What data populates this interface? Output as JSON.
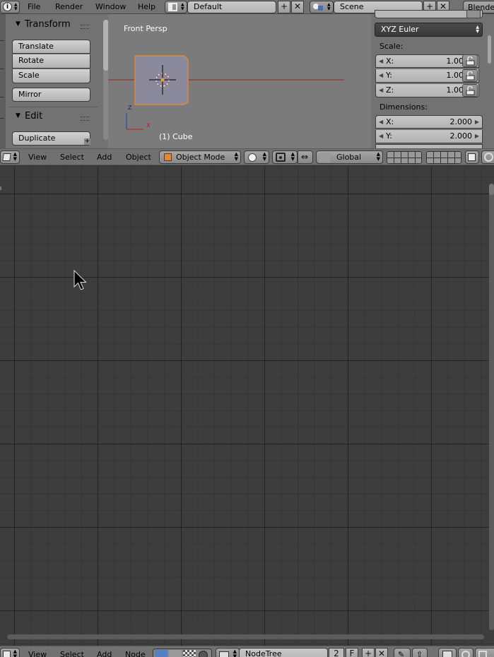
{
  "topbar": {
    "menus": [
      "File",
      "Render",
      "Window",
      "Help"
    ],
    "screen_layout": "Default",
    "scene": "Scene",
    "engine": "Blender"
  },
  "toolshelf": {
    "transform_header": "Transform",
    "transform_tools": [
      "Translate",
      "Rotate",
      "Scale"
    ],
    "mirror_label": "Mirror",
    "edit_header": "Edit",
    "duplicate_label": "Duplicate"
  },
  "viewport": {
    "view_name": "Front Persp",
    "object_label": "(1) Cube",
    "axis_z": "Z",
    "axis_x": "X"
  },
  "properties": {
    "rotation_mode": "XYZ Euler",
    "scale_label": "Scale:",
    "scale": [
      {
        "axis": "X:",
        "value": "1.000"
      },
      {
        "axis": "Y:",
        "value": "1.000"
      },
      {
        "axis": "Z:",
        "value": "1.000"
      }
    ],
    "dimensions_label": "Dimensions:",
    "dimensions": [
      {
        "axis": "X:",
        "value": "2.000"
      },
      {
        "axis": "Y:",
        "value": "2.000"
      }
    ]
  },
  "view3d_header": {
    "menus": [
      "View",
      "Select",
      "Add",
      "Object"
    ],
    "mode": "Object Mode",
    "orientation": "Global"
  },
  "node_header": {
    "menus": [
      "View",
      "Select",
      "Add",
      "Node"
    ],
    "tree_name": "NodeTree",
    "users": "2",
    "fake_user": "F"
  }
}
